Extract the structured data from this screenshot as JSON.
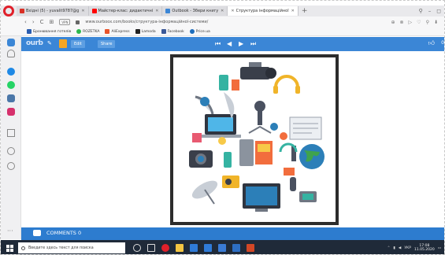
{
  "browser": {
    "tabs": [
      {
        "label": "Вхідні (5) - yuvalit9787@g",
        "fav_color": "#d93025",
        "active": false
      },
      {
        "label": "Майстер-клас: дидактичні",
        "fav_color": "#ff0000",
        "active": false
      },
      {
        "label": "Outbook - Збери книгу",
        "fav_color": "#3b86d6",
        "active": false
      },
      {
        "label": "Структура інформаційної",
        "fav_color": "#3b86d6",
        "active": true
      }
    ],
    "new_tab": "+",
    "nav": {
      "back": "‹",
      "forward": "›",
      "reload": "C",
      "home": "⊞"
    },
    "vpn_label": "VPN",
    "url": "www.ourboox.com/books/структура-інформаційної-системи/",
    "address_right_icons": [
      "⊕",
      "⊗",
      "▷",
      "♡",
      "⚲",
      "⬇"
    ],
    "bookmarks": [
      {
        "label": "Бронювання готелів",
        "color": "#2a5db0"
      },
      {
        "label": "ROZETKA",
        "color": "#2db84c"
      },
      {
        "label": "AliExpress",
        "color": "#e8542b"
      },
      {
        "label": "Lamoda",
        "color": "#222222"
      },
      {
        "label": "Facebook",
        "color": "#3b5998"
      },
      {
        "label": "Price.ua",
        "color": "#1e6ebd"
      }
    ]
  },
  "site": {
    "logo": "ourb",
    "edit_label": "Edit",
    "share_label": "Share",
    "like_count": "0"
  },
  "comments": {
    "label": "COMMENTS 0"
  },
  "taskbar": {
    "search_placeholder": "Введите здесь текст для поиска",
    "language": "УКР",
    "time": "17:08",
    "date": "11.05.2020"
  },
  "colors": {
    "site_blue": "#3b86d6",
    "comments_blue": "#2d7ccf",
    "taskbar": "#1f2a39"
  }
}
